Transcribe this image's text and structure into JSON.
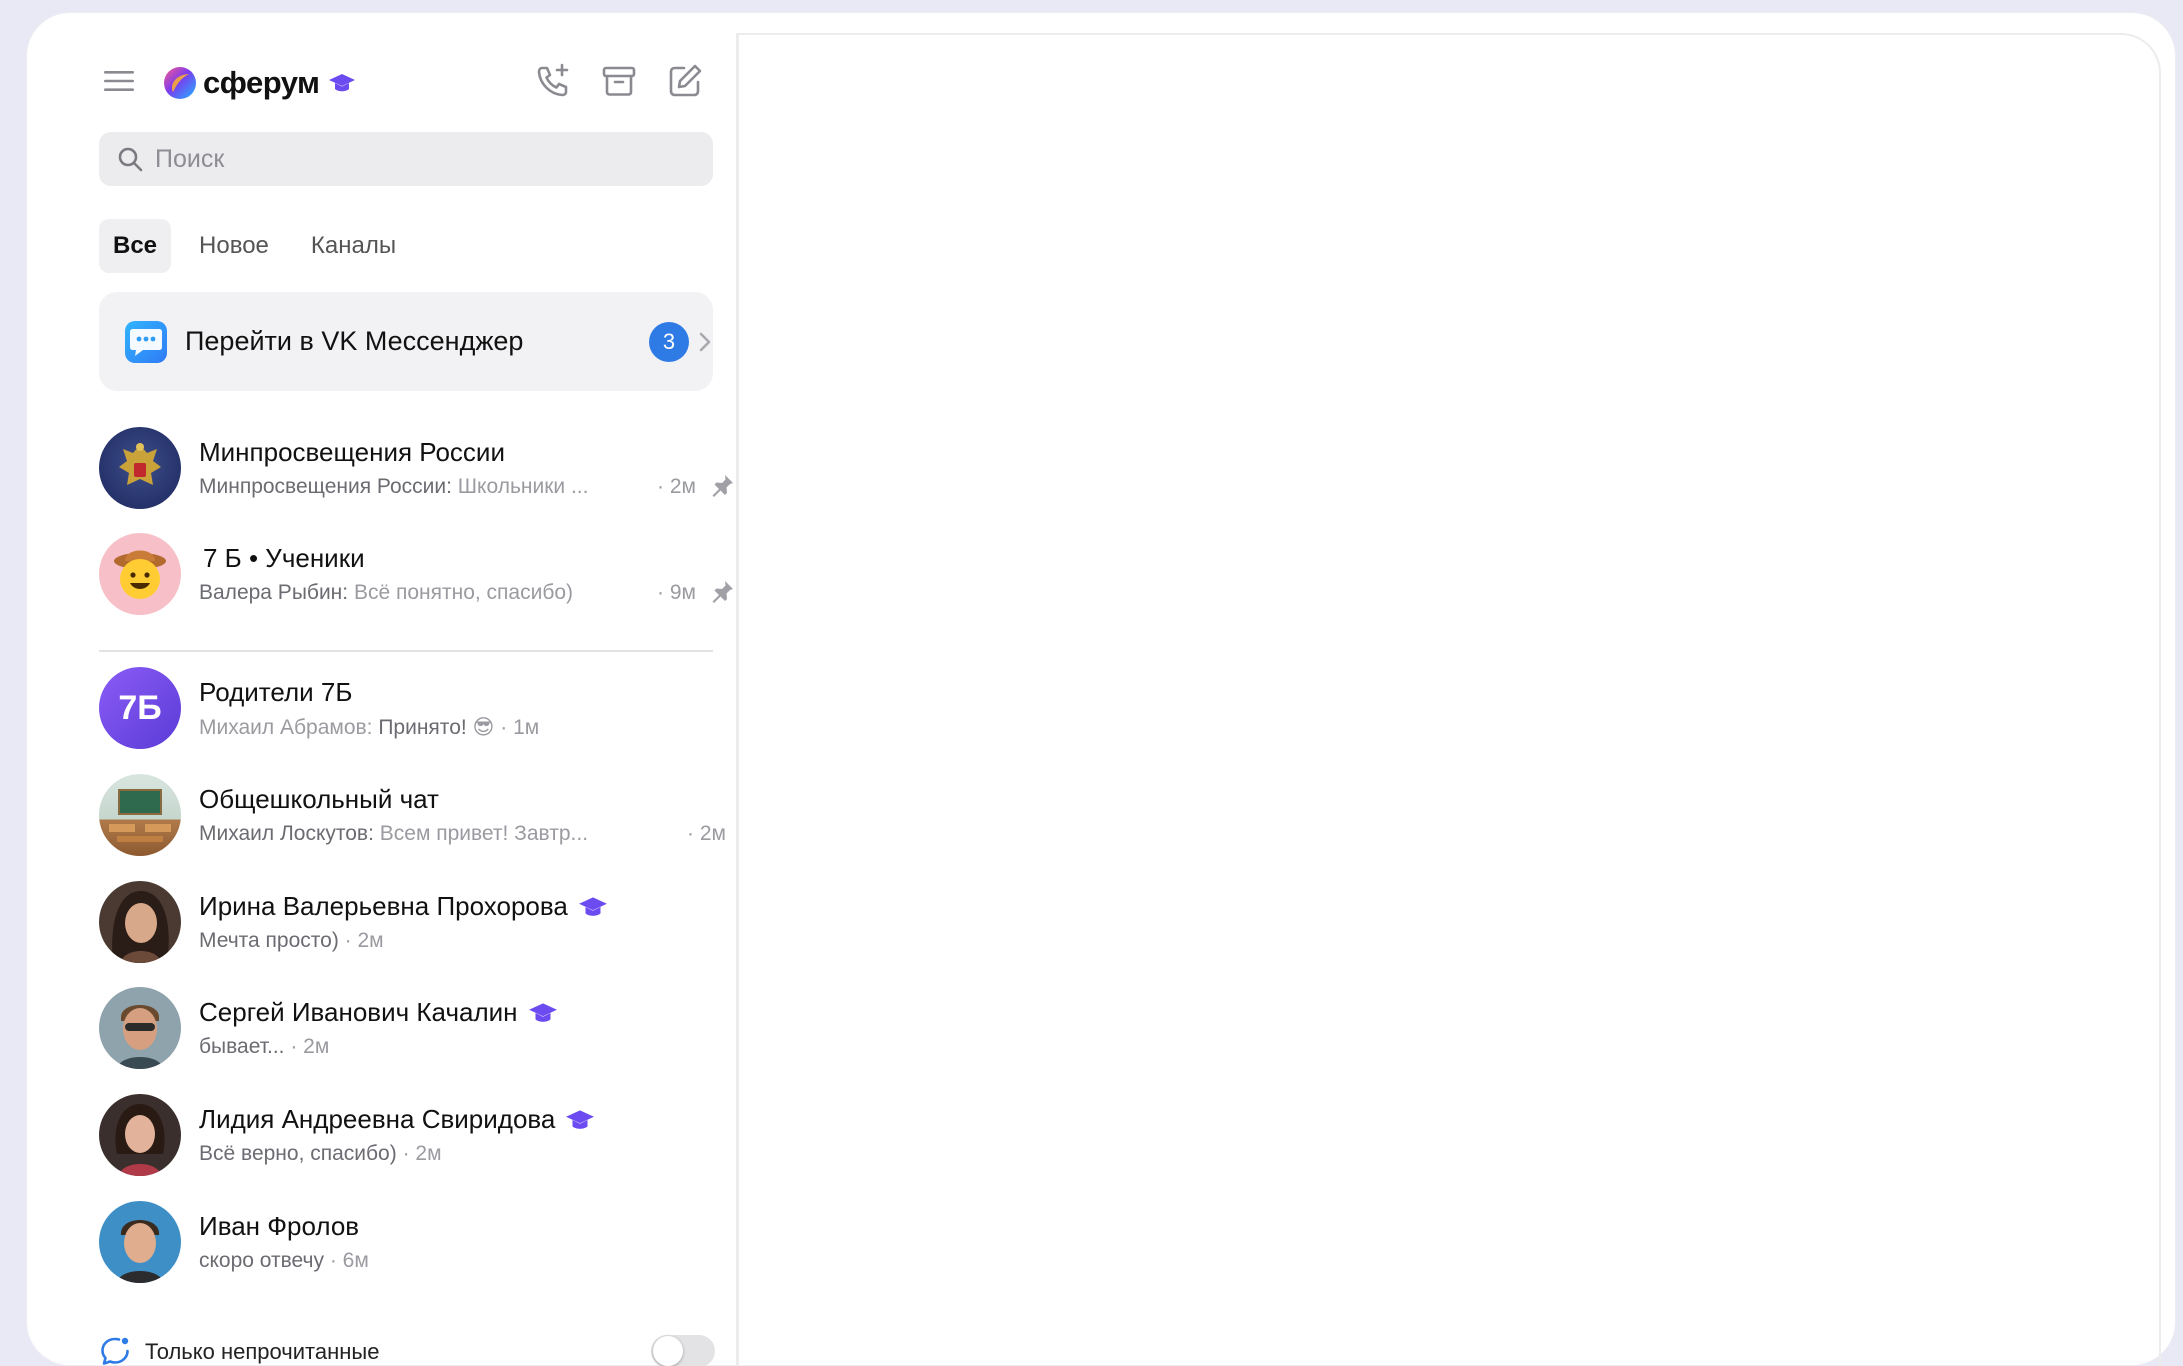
{
  "app": {
    "brand": "сферум"
  },
  "search": {
    "placeholder": "Поиск"
  },
  "tabs": [
    {
      "label": "Все"
    },
    {
      "label": "Новое"
    },
    {
      "label": "Каналы"
    }
  ],
  "vk_banner": {
    "label": "Перейти в VK Мессенджер",
    "badge": "3"
  },
  "chats": [
    {
      "name": "Минпросвещения России",
      "author": "Минпросвещения России:",
      "message": " Школьники ...",
      "time": "· 2м",
      "pinned": true
    },
    {
      "name": "7 Б • Ученики",
      "author": "Валера Рыбин:",
      "message": " Всё понятно, спасибо)",
      "time": "· 9м",
      "pinned": true
    },
    {
      "name": "Родители 7Б",
      "author": "Михаил Абрамов:",
      "message": " Принято! ",
      "emoji": "😎",
      "time": " · 1м",
      "avatar_text": "7Б"
    },
    {
      "name": "Общешкольный чат",
      "author": "Михаил Лоскутов:",
      "message": " Всем привет! Завтр...",
      "time": "· 2м"
    },
    {
      "name": "Ирина Валерьевна Прохорова",
      "message": "Мечта просто)",
      "time": " · 2м",
      "verified": true
    },
    {
      "name": "Сергей Иванович Качалин",
      "message": "бывает...",
      "time": " · 2м",
      "verified": true
    },
    {
      "name": "Лидия Андреевна Свиридова",
      "message": "Всё верно, спасибо)",
      "time": " · 2м",
      "verified": true
    },
    {
      "name": "Иван Фролов",
      "message": "скоро отвечу",
      "time": " · 6м"
    }
  ],
  "footer": {
    "label": "Только непрочитанные",
    "toggle_on": false
  },
  "colors": {
    "accent": "#2e7be6",
    "brand_purple": "#6c4cf1"
  }
}
